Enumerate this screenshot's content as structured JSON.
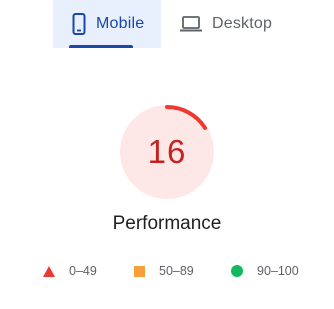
{
  "tabs": [
    {
      "label": "Mobile",
      "icon": "smartphone-icon",
      "selected": true
    },
    {
      "label": "Desktop",
      "icon": "laptop-icon",
      "selected": false
    }
  ],
  "gauge": {
    "score": "16",
    "score_fraction": 0.16,
    "title": "Performance",
    "color": "#eb3a32",
    "track_color": "#fde8e7"
  },
  "legend": [
    {
      "shape": "triangle",
      "range": "0–49",
      "color": "#eb3a32"
    },
    {
      "shape": "square",
      "range": "50–89",
      "color": "#f5a03b"
    },
    {
      "shape": "circle",
      "range": "90–100",
      "color": "#12b85d"
    }
  ]
}
